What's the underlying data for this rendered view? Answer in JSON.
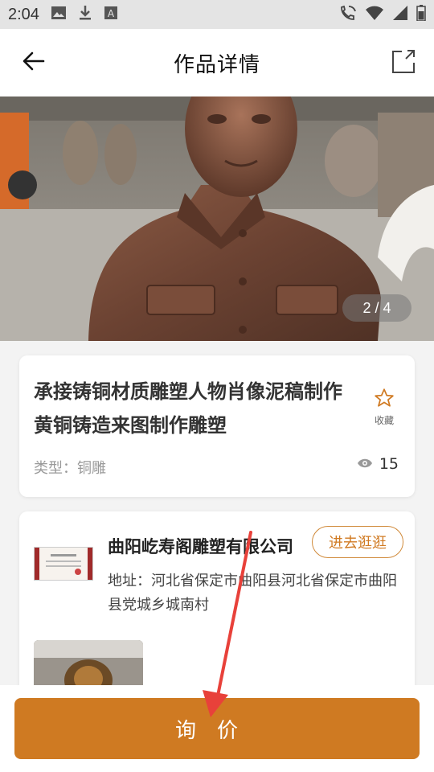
{
  "status_bar": {
    "time": "2:04",
    "icons": [
      "image-icon",
      "download-icon",
      "a-box-icon",
      "phone-wifi-icon",
      "wifi-icon",
      "signal-icon",
      "battery-icon"
    ]
  },
  "appbar": {
    "title": "作品详情",
    "back_icon": "arrow-left-icon",
    "share_icon": "share-icon"
  },
  "gallery": {
    "current": 2,
    "total": 4,
    "indicator": "2 / 4"
  },
  "product": {
    "title": "承接铸铜材质雕塑人物肖像泥稿制作黄铜铸造来图制作雕塑",
    "favorite_label": "收藏",
    "type_text": "类型：铜雕",
    "view_count": "15"
  },
  "company": {
    "name": "曲阳屹寿阁雕塑有限公司",
    "visit_label": "进去逛逛",
    "address": "地址：河北省保定市曲阳县河北省保定市曲阳县党城乡城南村"
  },
  "bottom": {
    "inquire_label": "询价"
  },
  "colors": {
    "accent": "#cf7a22",
    "annotation_arrow": "#e8413a"
  }
}
